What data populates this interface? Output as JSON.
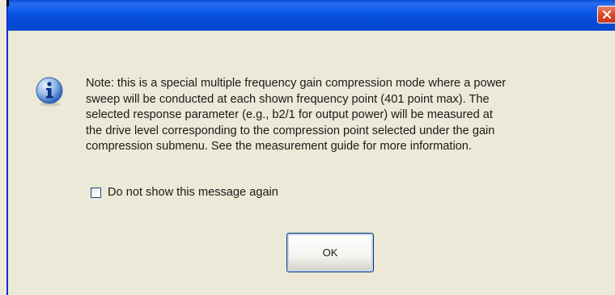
{
  "dialog": {
    "message": "Note: this is a special multiple frequency gain compression mode where a power\nsweep will be conducted at each shown frequency point (401 point max).  The\nselected response parameter (e.g., b2/1 for output power) will be measured at\nthe drive level corresponding to the compression point selected under  the gain\ncompression submenu.  See the measurement guide for more information.",
    "checkbox_label": "Do not show this message again",
    "checkbox_checked": false,
    "ok_label": "OK",
    "icon": "info-icon"
  },
  "colors": {
    "titlebar": "#0b58e6",
    "close_button": "#d9471f",
    "background": "#ece9d8"
  }
}
